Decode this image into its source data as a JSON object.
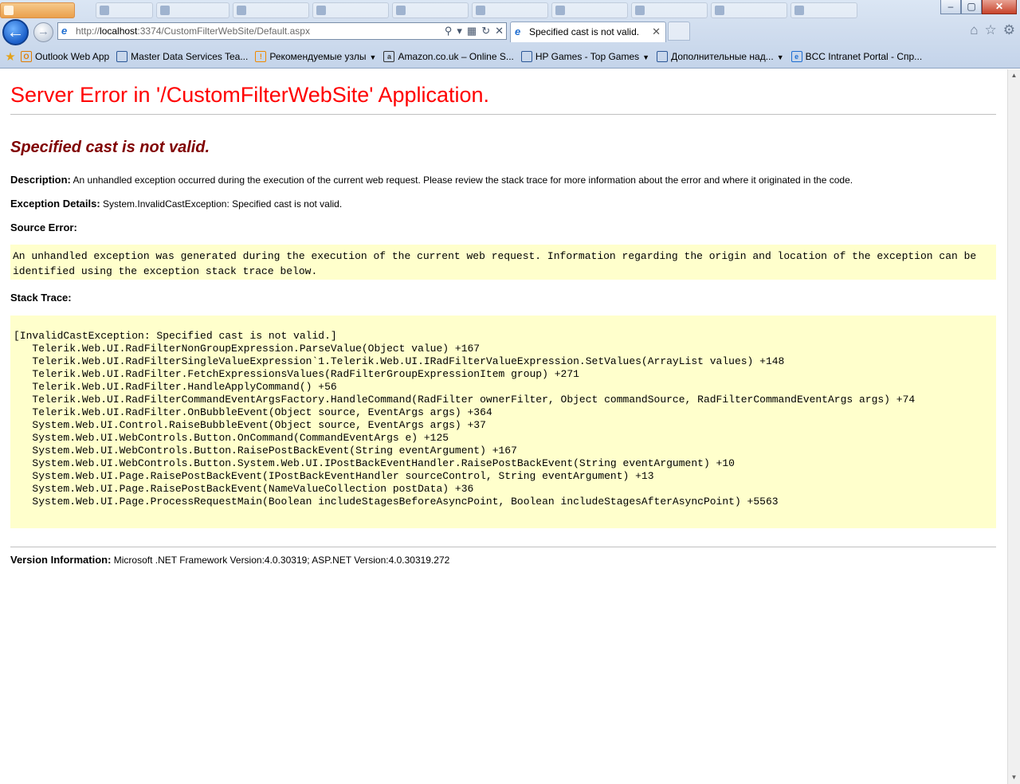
{
  "browser": {
    "background_tabs": [
      "",
      "",
      "",
      "",
      "",
      "",
      "",
      "",
      "",
      "",
      ""
    ],
    "window_buttons": {
      "minimize": "–",
      "maximize": "▢",
      "close": "✕"
    },
    "address": {
      "prefix": "http://",
      "host": "localhost",
      "path": ":3374/CustomFilterWebSite/Default.aspx"
    },
    "active_tab_title": "Specified cast is not valid.",
    "favorites": [
      {
        "label": "Outlook Web App",
        "icon": "outlook-icon",
        "icon_glyph": "O",
        "icon_color": "#e07b00",
        "dropdown": false
      },
      {
        "label": "Master Data Services Tea...",
        "icon": "page-icon",
        "icon_glyph": "",
        "icon_color": "#2b5797",
        "dropdown": false
      },
      {
        "label": "Рекомендуемые узлы",
        "icon": "suggested-sites-icon",
        "icon_glyph": "!",
        "icon_color": "#f08a00",
        "dropdown": true
      },
      {
        "label": "Amazon.co.uk – Online S...",
        "icon": "amazon-icon",
        "icon_glyph": "a",
        "icon_color": "#333333",
        "dropdown": false
      },
      {
        "label": "HP Games - Top Games",
        "icon": "page-icon",
        "icon_glyph": "",
        "icon_color": "#2b5797",
        "dropdown": true
      },
      {
        "label": "Дополнительные над...",
        "icon": "page-icon",
        "icon_glyph": "",
        "icon_color": "#2b5797",
        "dropdown": true
      },
      {
        "label": "BCC Intranet Portal - Спр...",
        "icon": "ie-icon",
        "icon_glyph": "e",
        "icon_color": "#1d6dd1",
        "dropdown": false
      }
    ]
  },
  "page": {
    "title": "Server Error in '/CustomFilterWebSite' Application.",
    "subtitle": "Specified cast is not valid.",
    "description_label": "Description:",
    "description_text": "An unhandled exception occurred during the execution of the current web request. Please review the stack trace for more information about the error and where it originated in the code.",
    "exception_label": "Exception Details:",
    "exception_text": "System.InvalidCastException: Specified cast is not valid.",
    "source_error_label": "Source Error:",
    "source_error_text": "An unhandled exception was generated during the execution of the current web request. Information regarding the origin and location of the exception can be identified using the exception stack trace below.",
    "stack_trace_label": "Stack Trace:",
    "stack_trace": [
      "[InvalidCastException: Specified cast is not valid.]",
      "   Telerik.Web.UI.RadFilterNonGroupExpression.ParseValue(Object value) +167",
      "   Telerik.Web.UI.RadFilterSingleValueExpression`1.Telerik.Web.UI.IRadFilterValueExpression.SetValues(ArrayList values) +148",
      "   Telerik.Web.UI.RadFilter.FetchExpressionsValues(RadFilterGroupExpressionItem group) +271",
      "   Telerik.Web.UI.RadFilter.HandleApplyCommand() +56",
      "   Telerik.Web.UI.RadFilterCommandEventArgsFactory.HandleCommand(RadFilter ownerFilter, Object commandSource, RadFilterCommandEventArgs args) +74",
      "   Telerik.Web.UI.RadFilter.OnBubbleEvent(Object source, EventArgs args) +364",
      "   System.Web.UI.Control.RaiseBubbleEvent(Object source, EventArgs args) +37",
      "   System.Web.UI.WebControls.Button.OnCommand(CommandEventArgs e) +125",
      "   System.Web.UI.WebControls.Button.RaisePostBackEvent(String eventArgument) +167",
      "   System.Web.UI.WebControls.Button.System.Web.UI.IPostBackEventHandler.RaisePostBackEvent(String eventArgument) +10",
      "   System.Web.UI.Page.RaisePostBackEvent(IPostBackEventHandler sourceControl, String eventArgument) +13",
      "   System.Web.UI.Page.RaisePostBackEvent(NameValueCollection postData) +36",
      "   System.Web.UI.Page.ProcessRequestMain(Boolean includeStagesBeforeAsyncPoint, Boolean includeStagesAfterAsyncPoint) +5563"
    ],
    "version_label": "Version Information:",
    "version_text": "Microsoft .NET Framework Version:4.0.30319; ASP.NET Version:4.0.30319.272"
  },
  "colors": {
    "title": "#ff0000",
    "subtitle": "#800000",
    "code_background": "#ffffcc"
  }
}
